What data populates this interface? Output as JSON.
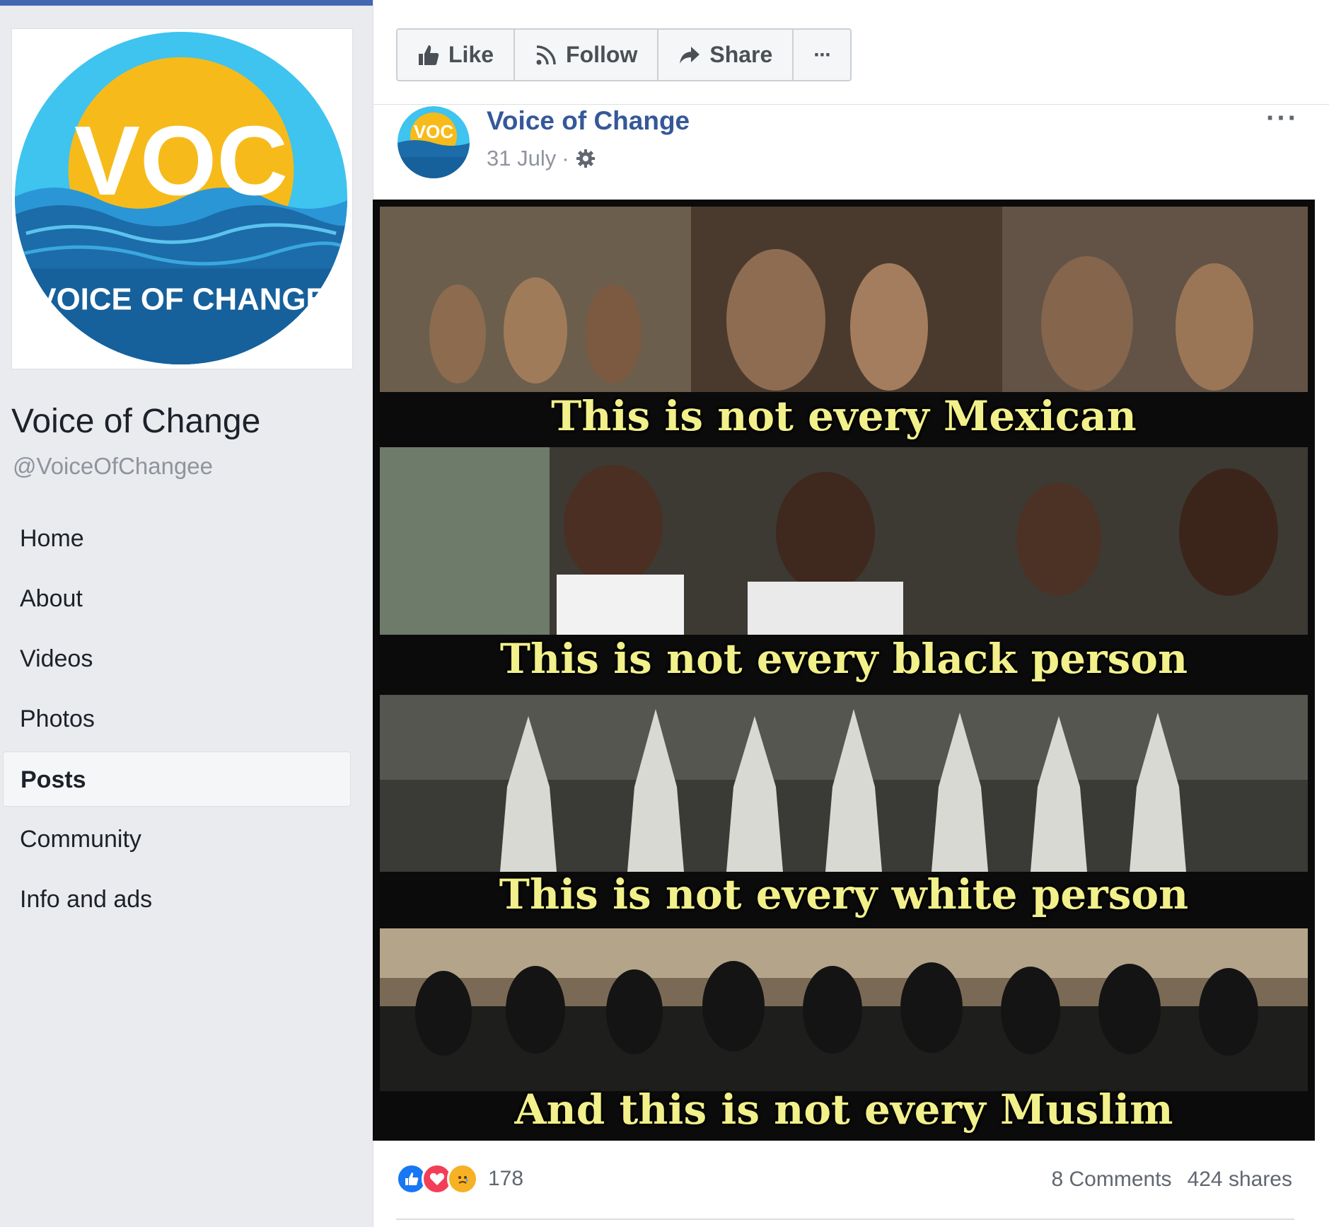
{
  "page": {
    "name": "Voice of Change",
    "handle": "@VoiceOfChangee",
    "logo_text_top": "VOC",
    "logo_text_bottom": "VOICE OF CHANGE"
  },
  "nav": {
    "items": [
      {
        "label": "Home"
      },
      {
        "label": "About"
      },
      {
        "label": "Videos"
      },
      {
        "label": "Photos"
      },
      {
        "label": "Posts",
        "active": true
      },
      {
        "label": "Community"
      },
      {
        "label": "Info and ads"
      }
    ]
  },
  "actions": {
    "like_label": "Like",
    "follow_label": "Follow",
    "share_label": "Share",
    "more_label": "···"
  },
  "post": {
    "author": "Voice of Change",
    "date": "31 July",
    "separator": "·",
    "more_label": "···",
    "image_captions": [
      "This is not every Mexican",
      "This is not every black person",
      "This is not every white person",
      "And this is not every Muslim"
    ],
    "reaction_count": "178",
    "comments": "8 Comments",
    "shares": "424 shares"
  },
  "colors": {
    "facebook_blue": "#4267b2",
    "link_blue": "#365899",
    "caption_yellow": "#f2f08a",
    "logo_sun": "#f6bb1a",
    "logo_sea": "#1b6ca8"
  }
}
